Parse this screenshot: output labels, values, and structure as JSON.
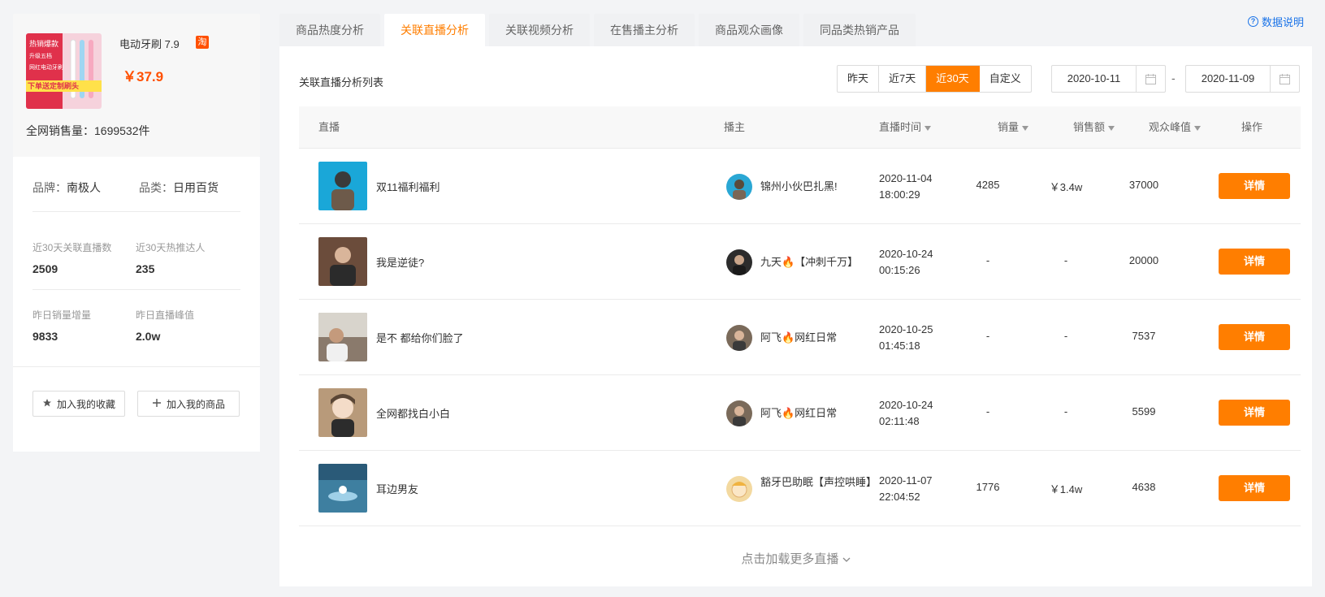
{
  "product": {
    "name": "电动牙刷 7.9",
    "badge": "淘",
    "price": "￥37.9",
    "sales_label": "全网销售量：",
    "sales_value": "1699532件",
    "image_text": [
      "热销爆款",
      "升级五档",
      "网红电动牙刷",
      "下单送定制刷头"
    ]
  },
  "stats": {
    "brand_label": "品牌：",
    "brand_value": "南极人",
    "category_label": "品类：",
    "category_value": "日用百货",
    "items": [
      {
        "label": "近30天关联直播数",
        "value": "2509"
      },
      {
        "label": "近30天热推达人",
        "value": "235"
      },
      {
        "label": "昨日销量增量",
        "value": "9833"
      },
      {
        "label": "昨日直播峰值",
        "value": "2.0w"
      }
    ],
    "favorite_button": "加入我的收藏",
    "add_product_button": "加入我的商品"
  },
  "tabs": [
    {
      "label": "商品热度分析",
      "active": false
    },
    {
      "label": "关联直播分析",
      "active": true
    },
    {
      "label": "关联视频分析",
      "active": false
    },
    {
      "label": "在售播主分析",
      "active": false
    },
    {
      "label": "商品观众画像",
      "active": false
    },
    {
      "label": "同品类热销产品",
      "active": false
    }
  ],
  "help_link": "数据说明",
  "list": {
    "title": "关联直播分析列表",
    "ranges": [
      {
        "label": "昨天",
        "active": false
      },
      {
        "label": "近7天",
        "active": false
      },
      {
        "label": "近30天",
        "active": true
      },
      {
        "label": "自定义",
        "active": false
      }
    ],
    "date_start": "2020-10-11",
    "date_sep": "-",
    "date_end": "2020-11-09",
    "columns": {
      "live": "直播",
      "host": "播主",
      "time": "直播时间",
      "sales": "销量",
      "revenue": "销售额",
      "peak": "观众峰值",
      "action": "操作"
    },
    "rows": [
      {
        "title": "双11福利福利",
        "host": "锦州小伙巴扎黑!",
        "date": "2020-11-04",
        "time": "18:00:29",
        "sales": "4285",
        "revenue": "￥3.4w",
        "peak": "37000",
        "action": "详情",
        "thumb_color": "#1aa7d8",
        "avatar_color": "#2aa7d4"
      },
      {
        "title": "我是逆徒?",
        "host": "九天🔥【冲刺千万】",
        "date": "2020-10-24",
        "time": "00:15:26",
        "sales": "-",
        "revenue": "-",
        "peak": "20000",
        "action": "详情",
        "thumb_color": "#6b4c3b",
        "avatar_color": "#2c2c2c"
      },
      {
        "title": "是不 都给你们脸了",
        "host": "阿飞🔥网红日常",
        "date": "2020-10-25",
        "time": "01:45:18",
        "sales": "-",
        "revenue": "-",
        "peak": "7537",
        "action": "详情",
        "thumb_color": "#8a7a6c",
        "avatar_color": "#7a6a5a"
      },
      {
        "title": "全网都找白小白",
        "host": "阿飞🔥网红日常",
        "date": "2020-10-24",
        "time": "02:11:48",
        "sales": "-",
        "revenue": "-",
        "peak": "5599",
        "action": "详情",
        "thumb_color": "#b89a7a",
        "avatar_color": "#7a6a5a"
      },
      {
        "title": "耳边男友",
        "host": "豁牙巴助眠【声控哄睡】",
        "date": "2020-11-07",
        "time": "22:04:52",
        "sales": "1776",
        "revenue": "￥1.4w",
        "peak": "4638",
        "action": "详情",
        "thumb_color": "#3e7fa0",
        "avatar_color": "#f3d9a0"
      }
    ],
    "load_more": "点击加载更多直播"
  },
  "colors": {
    "accent": "#ff7e00",
    "price": "#ff5000",
    "link": "#1a73e8"
  }
}
